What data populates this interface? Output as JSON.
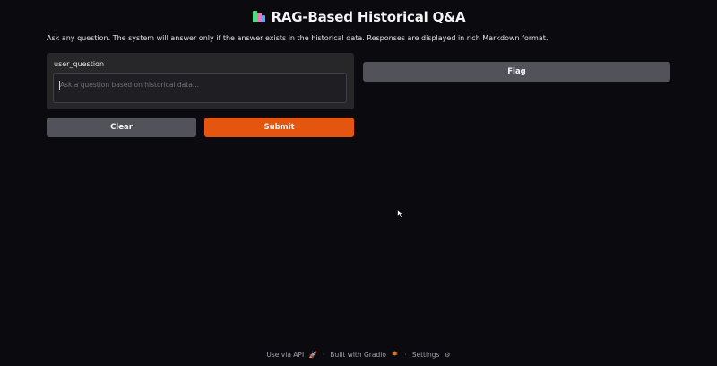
{
  "header": {
    "title": "RAG-Based Historical Q&A",
    "title_icon": "books-icon"
  },
  "description": "Ask any question. The system will answer only if the answer exists in the historical data. Responses are displayed in rich Markdown format.",
  "input": {
    "label": "user_question",
    "placeholder": "Ask a question based on historical data...",
    "value": ""
  },
  "buttons": {
    "clear": "Clear",
    "submit": "Submit",
    "flag": "Flag"
  },
  "footer": {
    "api": "Use via API",
    "api_icon": "rocket-icon",
    "built": "Built with Gradio",
    "built_icon": "gradio-logo-icon",
    "settings": "Settings",
    "settings_icon": "gear-icon",
    "separator": "·"
  },
  "colors": {
    "background": "#0b0b0f",
    "panel": "#27272a",
    "primary": "#e4550f",
    "secondary": "#52525b"
  }
}
